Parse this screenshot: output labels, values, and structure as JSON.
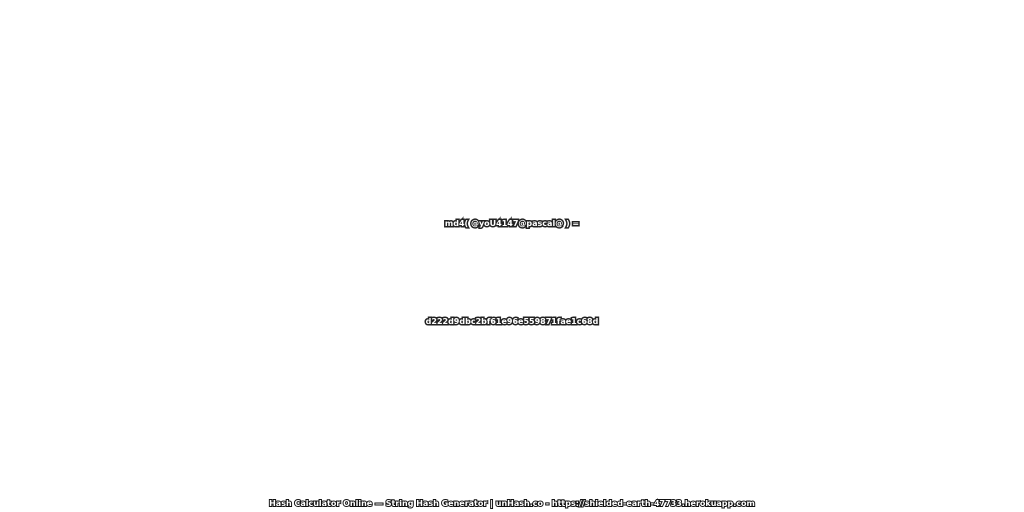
{
  "expression": "md4( @yoU4147@pascal@ ) =",
  "digest": "d222d9dbc2bf61e96e559871fae1c68d",
  "footer": "Hash Calculator Online — String Hash Generator | unHash.co - https://shielded-earth-47733.herokuapp.com"
}
